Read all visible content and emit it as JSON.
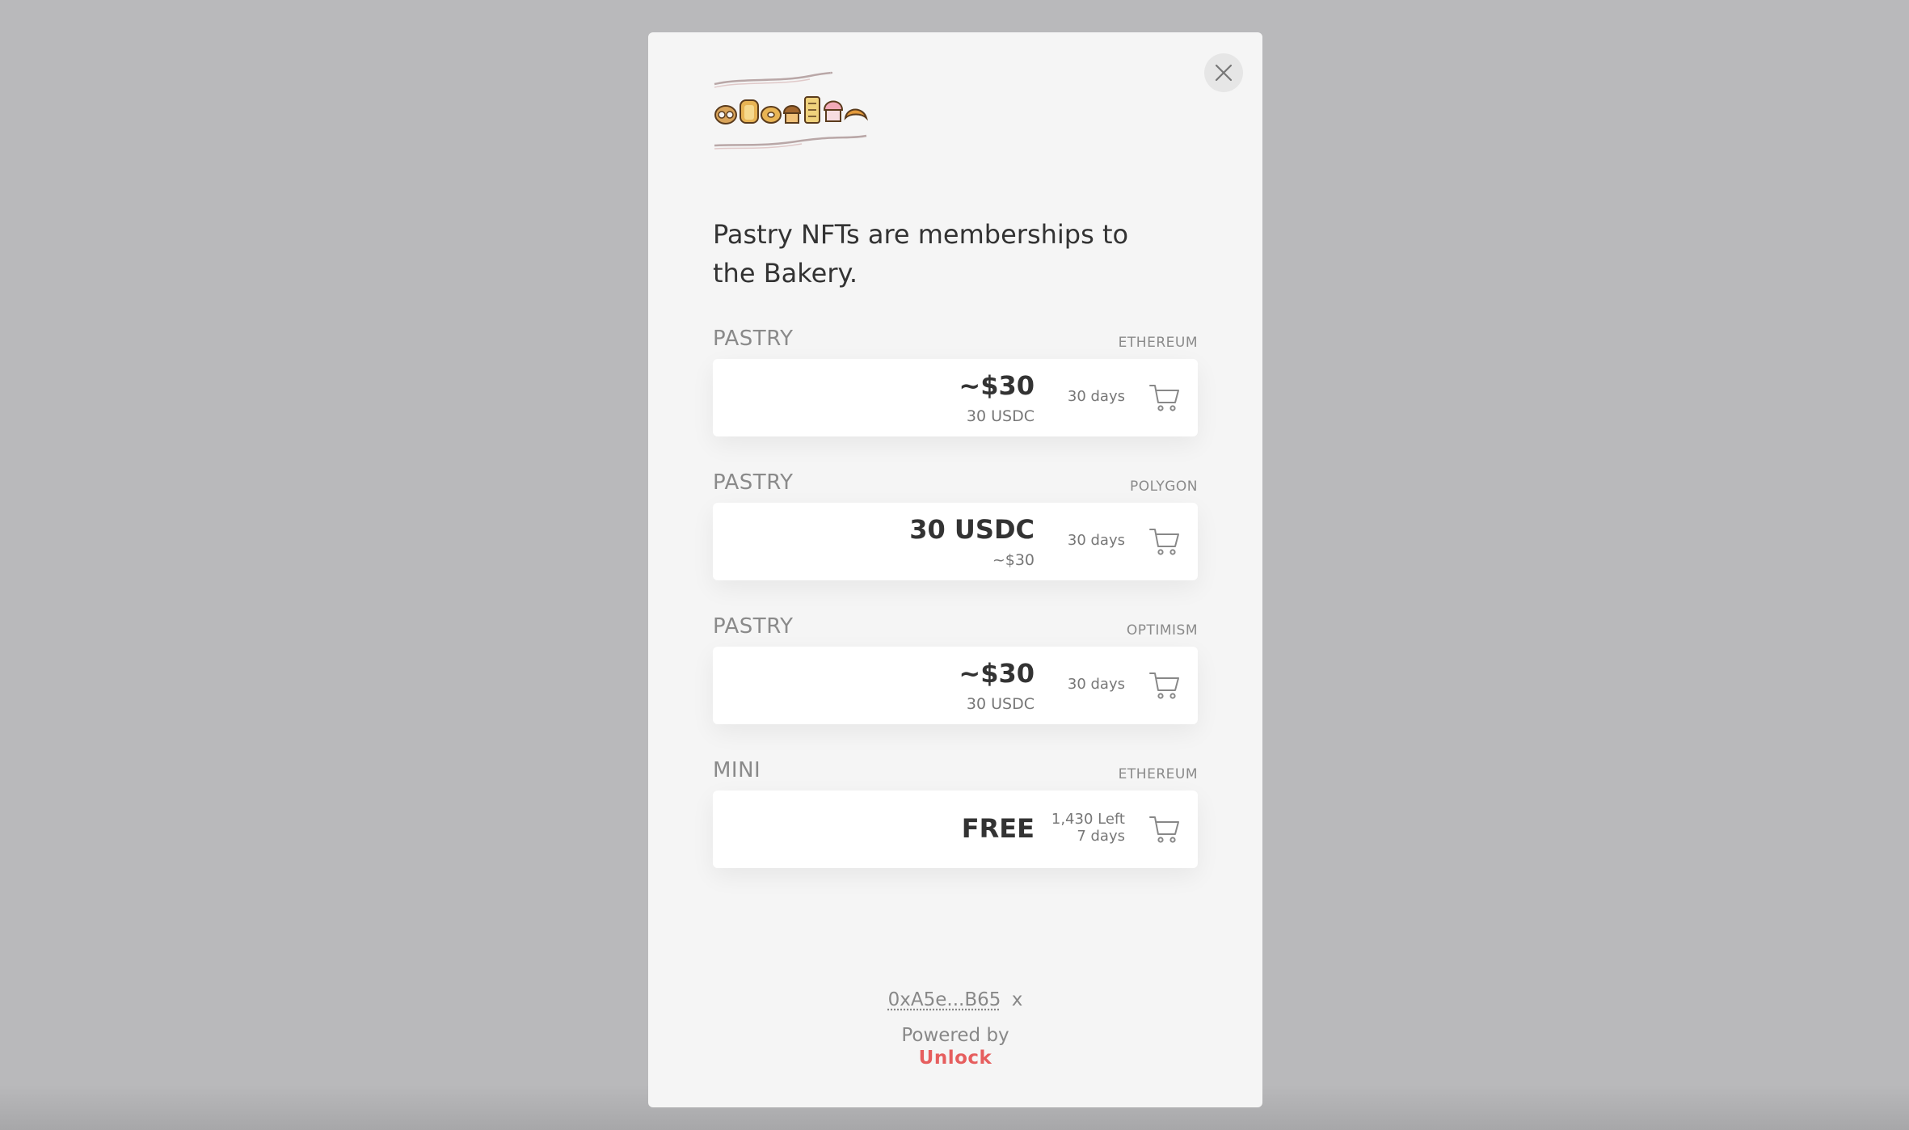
{
  "intro_text": "Pastry NFTs are memberships to the Bakery.",
  "close_label": "close",
  "locks": [
    {
      "name": "PASTRY",
      "network": "ETHEREUM",
      "price_main": "~$30",
      "price_sub": "30 USDC",
      "duration": "30 days",
      "left": ""
    },
    {
      "name": "PASTRY",
      "network": "POLYGON",
      "price_main": "30 USDC",
      "price_sub": "~$30",
      "duration": "30 days",
      "left": ""
    },
    {
      "name": "PASTRY",
      "network": "OPTIMISM",
      "price_main": "~$30",
      "price_sub": "30 USDC",
      "duration": "30 days",
      "left": ""
    },
    {
      "name": "MINI",
      "network": "ETHEREUM",
      "price_main": "FREE",
      "price_sub": "",
      "duration": "7 days",
      "left": "1,430 Left"
    }
  ],
  "footer": {
    "address": "0xA5e...B65",
    "logout": "x",
    "powered_by": "Powered by",
    "brand": "Unlock"
  },
  "colors": {
    "backdrop": "#b9b9bb",
    "modal_bg": "#f5f5f5",
    "card_bg": "#ffffff",
    "brand": "#e65e5e",
    "text_dark": "#333333",
    "text_muted": "#888888"
  },
  "icons": {
    "close": "close-icon",
    "cart": "shopping-cart-icon",
    "logo": "pastry-logo"
  }
}
